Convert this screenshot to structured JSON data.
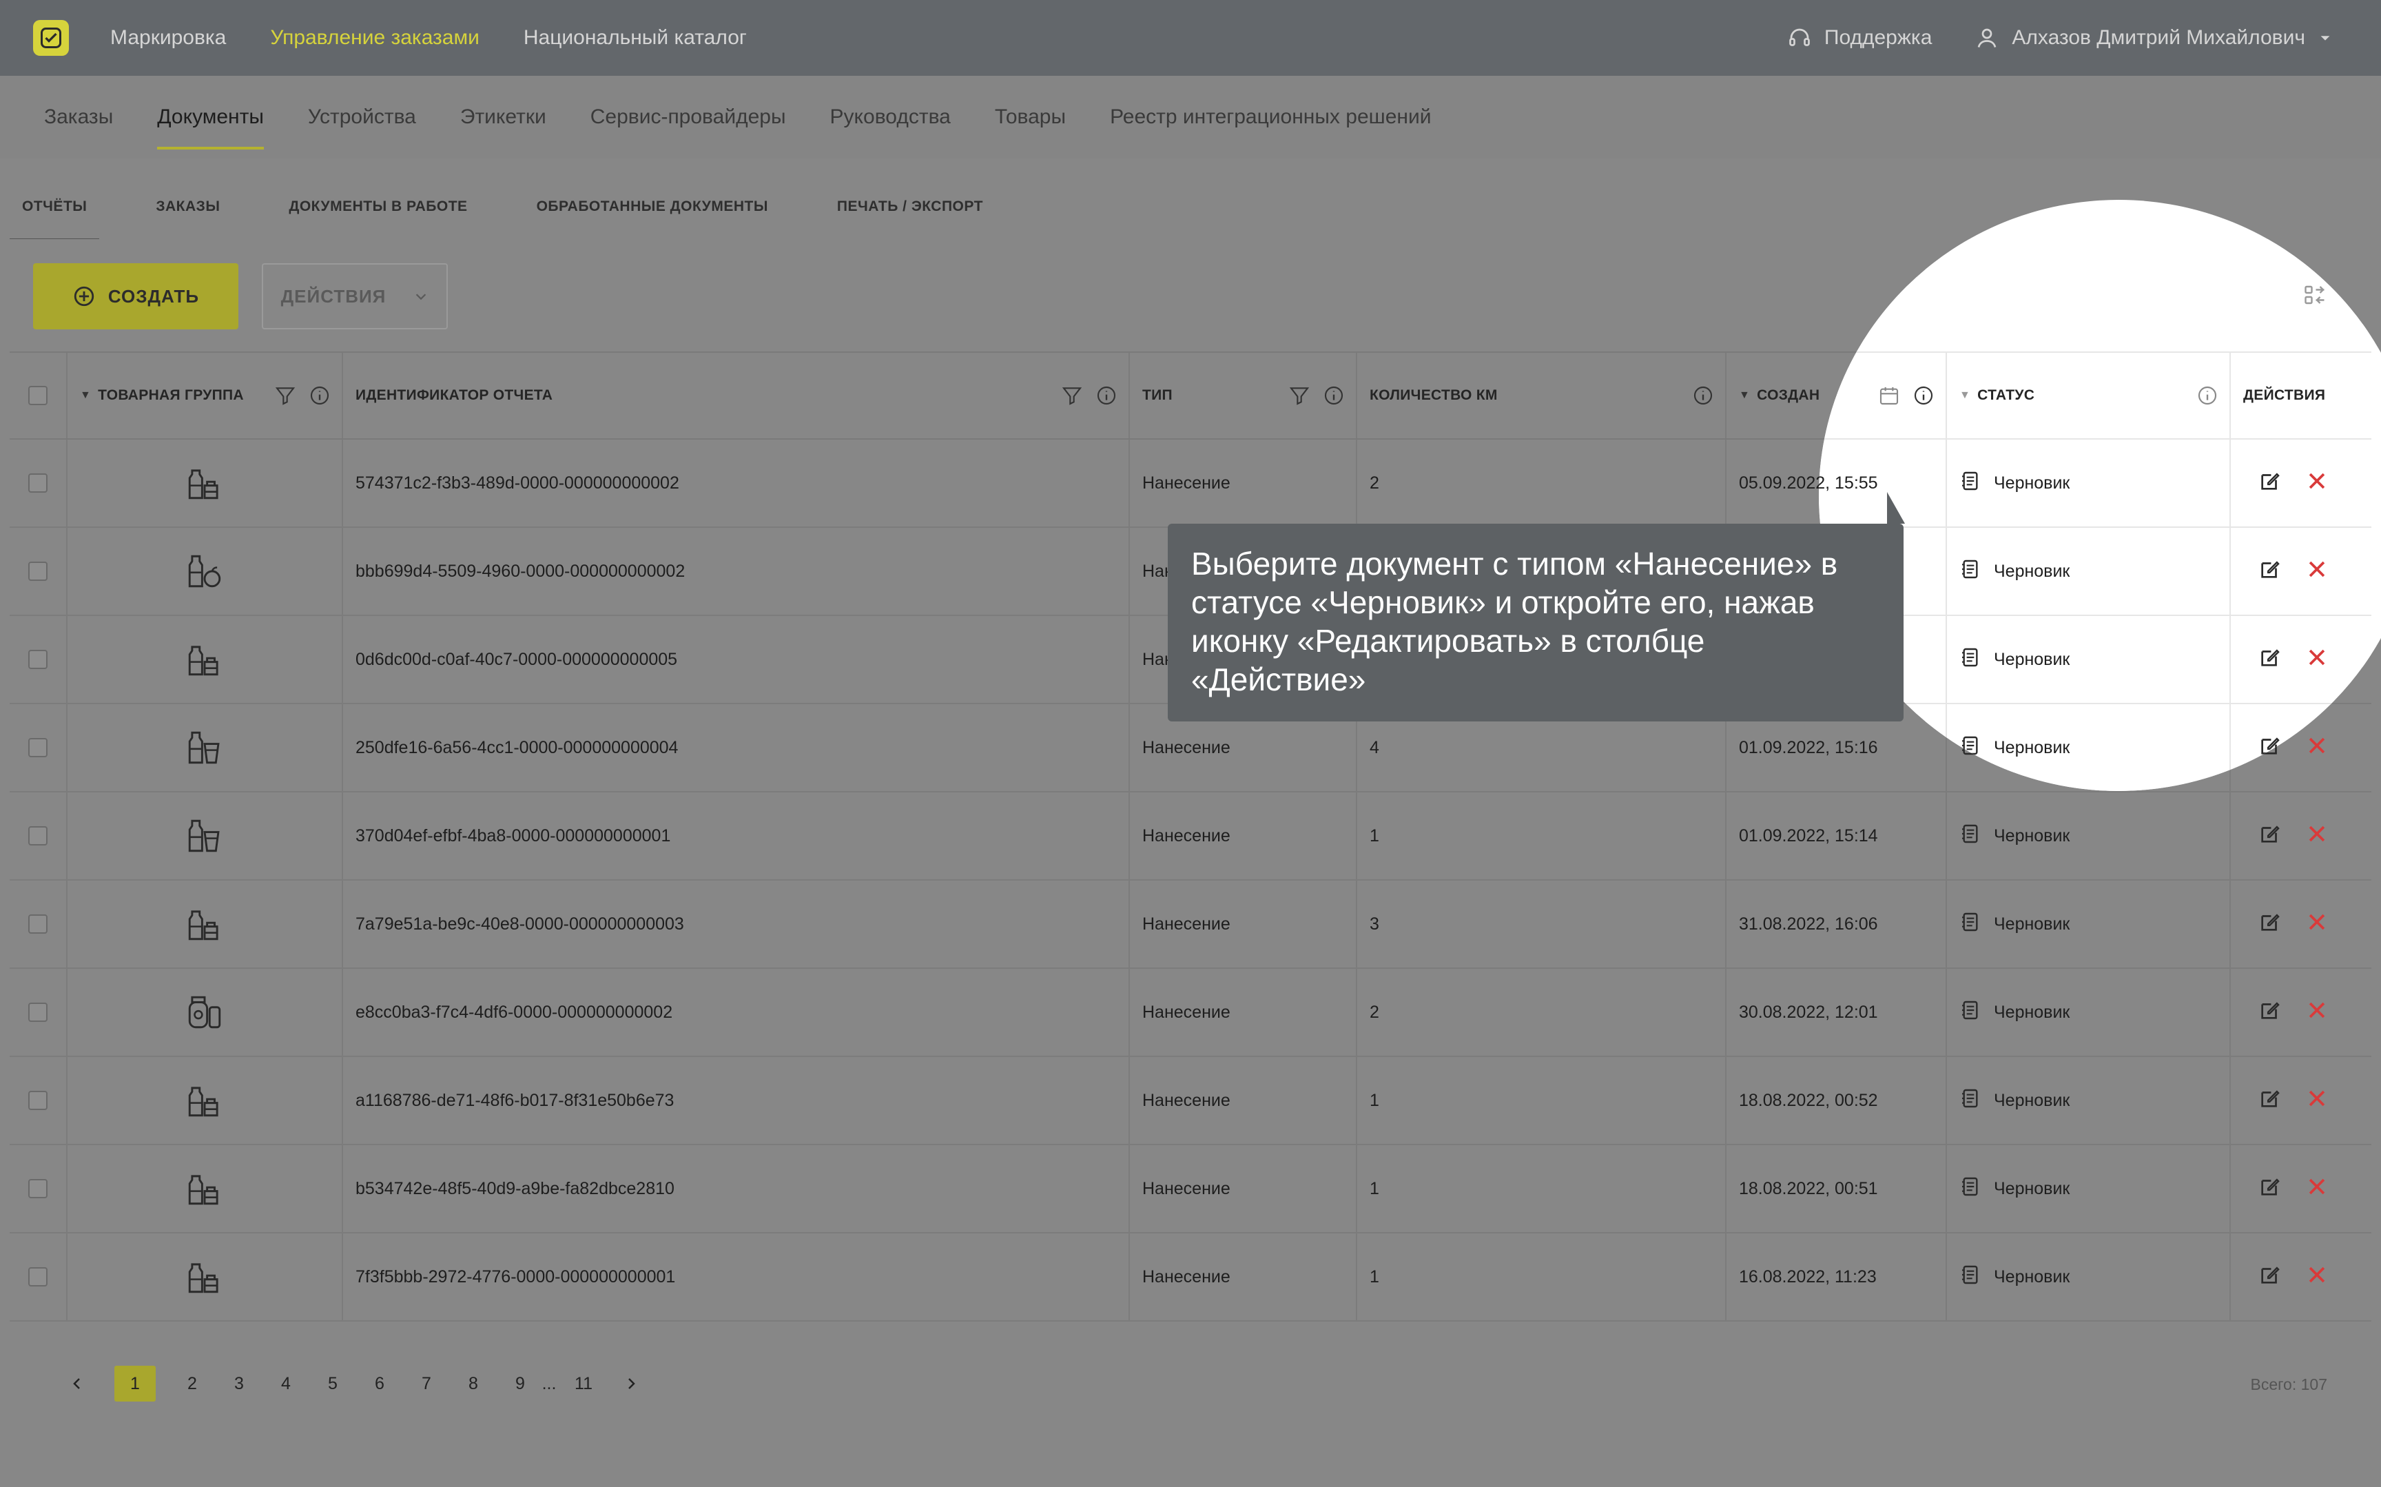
{
  "topbar": {
    "nav": [
      "Маркировка",
      "Управление заказами",
      "Национальный каталог"
    ],
    "active_nav_index": 1,
    "support": "Поддержка",
    "user": "Алхазов Дмитрий Михайлович"
  },
  "secnav": {
    "items": [
      "Заказы",
      "Документы",
      "Устройства",
      "Этикетки",
      "Сервис-провайдеры",
      "Руководства",
      "Товары",
      "Реестр интеграционных решений"
    ],
    "active_index": 1
  },
  "tabs": {
    "items": [
      "ОТЧЁТЫ",
      "ЗАКАЗЫ",
      "ДОКУМЕНТЫ В РАБОТЕ",
      "ОБРАБОТАННЫЕ ДОКУМЕНТЫ",
      "ПЕЧАТЬ / ЭКСПОРТ"
    ],
    "active_index": 0
  },
  "toolbar": {
    "create_label": "СОЗДАТЬ",
    "actions_label": "ДЕЙСТВИЯ"
  },
  "table": {
    "columns": {
      "group": "ТОВАРНАЯ ГРУППА",
      "id": "ИДЕНТИФИКАТОР ОТЧЕТА",
      "type": "ТИП",
      "qty": "КОЛИЧЕСТВО КМ",
      "created": "СОЗДАН",
      "status": "СТАТУС",
      "actions": "ДЕЙСТВИЯ"
    },
    "rows": [
      {
        "group_icon": "milk-bottles-icon",
        "id": "574371c2-f3b3-489d-0000-000000000002",
        "type": "Нанесение",
        "qty": "2",
        "created": "05.09.2022, 15:55",
        "status": "Черновик"
      },
      {
        "group_icon": "bottle-apple-icon",
        "id": "bbb699d4-5509-4960-0000-000000000002",
        "type": "Нанесение",
        "qty": "",
        "created": "",
        "status": "Черновик"
      },
      {
        "group_icon": "milk-bottles-icon",
        "id": "0d6dc00d-c0af-40c7-0000-000000000005",
        "type": "Нанесение",
        "qty": "",
        "created": "",
        "status": "Черновик"
      },
      {
        "group_icon": "bottle-glass-icon",
        "id": "250dfe16-6a56-4cc1-0000-000000000004",
        "type": "Нанесение",
        "qty": "4",
        "created": "01.09.2022, 15:16",
        "status": "Черновик"
      },
      {
        "group_icon": "bottle-glass-icon",
        "id": "370d04ef-efbf-4ba8-0000-000000000001",
        "type": "Нанесение",
        "qty": "1",
        "created": "01.09.2022, 15:14",
        "status": "Черновик"
      },
      {
        "group_icon": "milk-bottles-icon",
        "id": "7a79e51a-be9c-40e8-0000-000000000003",
        "type": "Нанесение",
        "qty": "3",
        "created": "31.08.2022, 16:06",
        "status": "Черновик"
      },
      {
        "group_icon": "supplement-jar-icon",
        "id": "e8cc0ba3-f7c4-4df6-0000-000000000002",
        "type": "Нанесение",
        "qty": "2",
        "created": "30.08.2022, 12:01",
        "status": "Черновик"
      },
      {
        "group_icon": "milk-bottles-icon",
        "id": "a1168786-de71-48f6-b017-8f31e50b6e73",
        "type": "Нанесение",
        "qty": "1",
        "created": "18.08.2022, 00:52",
        "status": "Черновик"
      },
      {
        "group_icon": "milk-bottles-icon",
        "id": "b534742e-48f5-40d9-a9be-fa82dbce2810",
        "type": "Нанесение",
        "qty": "1",
        "created": "18.08.2022, 00:51",
        "status": "Черновик"
      },
      {
        "group_icon": "milk-bottles-icon",
        "id": "7f3f5bbb-2972-4776-0000-000000000001",
        "type": "Нанесение",
        "qty": "1",
        "created": "16.08.2022, 11:23",
        "status": "Черновик"
      }
    ]
  },
  "pagination": {
    "pages": [
      "1",
      "2",
      "3",
      "4",
      "5",
      "6",
      "7",
      "8",
      "9",
      "...",
      "11"
    ],
    "active": "1",
    "total": "Всего: 107"
  },
  "tooltip": {
    "text": "Выберите документ с типом «Нанесение» в статусе «Черновик» и откройте его, нажав иконку «Редактировать»  в столбце «Действие»"
  },
  "colors": {
    "accent": "#d6d33c",
    "delete": "#d93a3a",
    "topbar": "#2f3438"
  }
}
